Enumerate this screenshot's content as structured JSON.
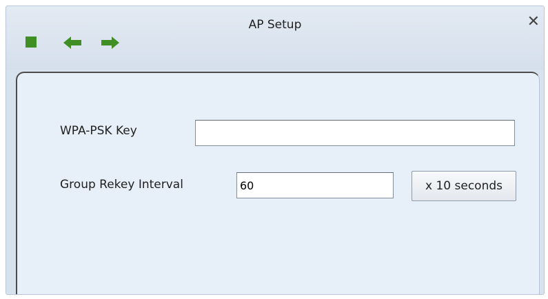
{
  "window": {
    "title": "AP Setup",
    "close_label": "✕"
  },
  "toolbar": {
    "icons": [
      "stop-icon",
      "back-arrow-icon",
      "forward-arrow-icon"
    ],
    "accent_color": "#3f8f24"
  },
  "form": {
    "wpa_label": "WPA-PSK Key",
    "wpa_value": "",
    "rekey_label": "Group Rekey Interval",
    "rekey_value": "60",
    "rekey_unit_button": "x 10 seconds"
  }
}
